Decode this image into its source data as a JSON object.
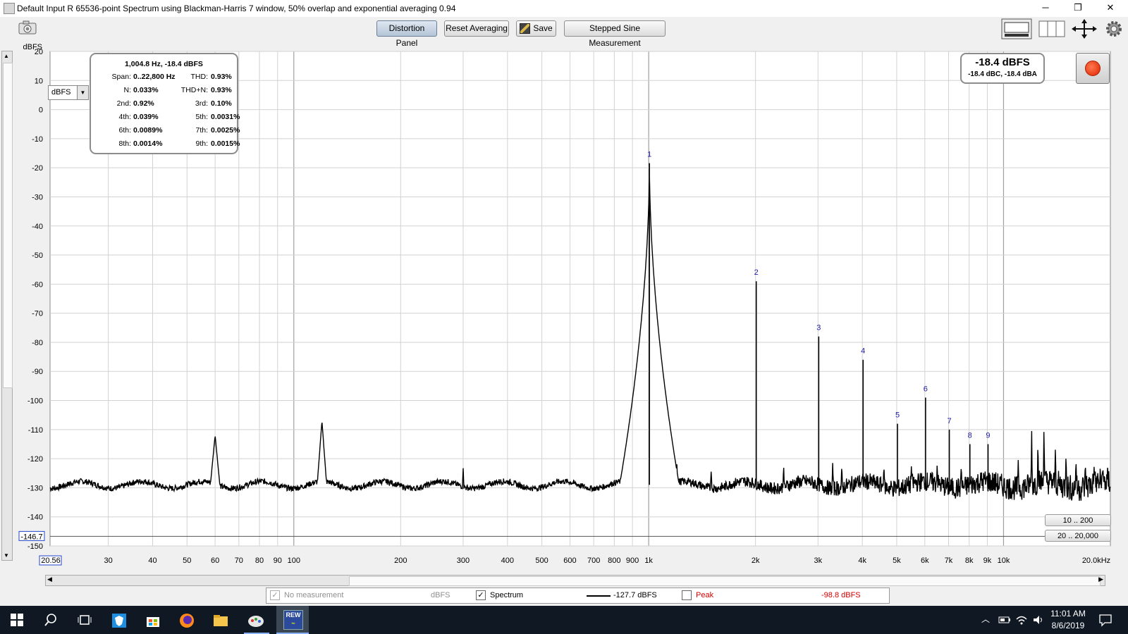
{
  "window": {
    "title": "Default Input R 65536-point Spectrum using Blackman-Harris 7 window, 50% overlap and exponential averaging 0.94",
    "minimize_glyph": "─",
    "restore_glyph": "❐",
    "close_glyph": "✕"
  },
  "toolbar": {
    "distortion_panel": "Distortion Panel",
    "reset_averaging": "Reset Averaging",
    "save": "Save",
    "stepped_sine": "Stepped Sine Measurement"
  },
  "icons": {
    "camera": "camera-icon",
    "screen_layout": "screen-layout-icon",
    "columns": "columns-icon",
    "expand": "expand-arrows-icon",
    "gear": "gear-icon",
    "record": "record-icon"
  },
  "distortion": {
    "header": "1,004.8 Hz, -18.4 dBFS",
    "rows": [
      {
        "l1": "Span:",
        "v1": "0..22,800 Hz",
        "l2": "THD:",
        "v2": "0.93%"
      },
      {
        "l1": "N:",
        "v1": "0.033%",
        "l2": "THD+N:",
        "v2": "0.93%"
      },
      {
        "l1": "2nd:",
        "v1": "0.92%",
        "l2": "3rd:",
        "v2": "0.10%"
      },
      {
        "l1": "4th:",
        "v1": "0.039%",
        "l2": "5th:",
        "v2": "0.0031%"
      },
      {
        "l1": "6th:",
        "v1": "0.0089%",
        "l2": "7th:",
        "v2": "0.0025%"
      },
      {
        "l1": "8th:",
        "v1": "0.0014%",
        "l2": "9th:",
        "v2": "0.0015%"
      }
    ]
  },
  "level": {
    "main": "-18.4 dBFS",
    "sub": "-18.4 dBC, -18.4 dBA"
  },
  "unit_select": {
    "value": "dBFS"
  },
  "range_buttons": {
    "r1": "10 .. 200",
    "r2": "20 .. 20,000"
  },
  "legend": {
    "no_measurement": "No measurement",
    "no_measurement_unit": "dBFS",
    "spectrum": "Spectrum",
    "spectrum_value": "-127.7 dBFS",
    "peak": "Peak",
    "peak_value": "-98.8 dBFS",
    "peak_color": "#d40000"
  },
  "chart_data": {
    "type": "line",
    "ylabel": "dBFS",
    "xscale": "log",
    "xlim": [
      20.56,
      20000
    ],
    "ylim": [
      -150,
      20
    ],
    "grid": true,
    "y_ticks": [
      "20",
      "10",
      "0",
      "-10",
      "-20",
      "-30",
      "-40",
      "-50",
      "-60",
      "-70",
      "-80",
      "-90",
      "-100",
      "-110",
      "-120",
      "-130",
      "-140",
      "-150"
    ],
    "x_ticks": [
      {
        "f": 30,
        "label": "30"
      },
      {
        "f": 40,
        "label": "40"
      },
      {
        "f": 50,
        "label": "50"
      },
      {
        "f": 60,
        "label": "60"
      },
      {
        "f": 70,
        "label": "70"
      },
      {
        "f": 80,
        "label": "80"
      },
      {
        "f": 90,
        "label": "90"
      },
      {
        "f": 100,
        "label": "100"
      },
      {
        "f": 200,
        "label": "200"
      },
      {
        "f": 300,
        "label": "300"
      },
      {
        "f": 400,
        "label": "400"
      },
      {
        "f": 500,
        "label": "500"
      },
      {
        "f": 600,
        "label": "600"
      },
      {
        "f": 700,
        "label": "700"
      },
      {
        "f": 800,
        "label": "800"
      },
      {
        "f": 900,
        "label": "900"
      },
      {
        "f": 1000,
        "label": "1k"
      },
      {
        "f": 2000,
        "label": "2k"
      },
      {
        "f": 3000,
        "label": "3k"
      },
      {
        "f": 4000,
        "label": "4k"
      },
      {
        "f": 5000,
        "label": "5k"
      },
      {
        "f": 6000,
        "label": "6k"
      },
      {
        "f": 7000,
        "label": "7k"
      },
      {
        "f": 8000,
        "label": "8k"
      },
      {
        "f": 9000,
        "label": "9k"
      },
      {
        "f": 10000,
        "label": "10k"
      },
      {
        "f": 20000,
        "label": "20.0kHz"
      }
    ],
    "x_start_label": "20.56",
    "y_cursor_label": "-146.7",
    "y_cursor_value": -146.7,
    "noise_floor_db": -129,
    "spurs": [
      {
        "f": 60,
        "db": -112
      },
      {
        "f": 120,
        "db": -107
      },
      {
        "f": 300,
        "db": -123
      },
      {
        "f": 1200,
        "db": -121
      },
      {
        "f": 1500,
        "db": -124
      },
      {
        "f": 2400,
        "db": -122
      },
      {
        "f": 3300,
        "db": -121
      },
      {
        "f": 3500,
        "db": -122
      },
      {
        "f": 4600,
        "db": -122
      },
      {
        "f": 5500,
        "db": -122
      },
      {
        "f": 6500,
        "db": -121
      },
      {
        "f": 7600,
        "db": -122
      },
      {
        "f": 11000,
        "db": -120
      },
      {
        "f": 12000,
        "db": -110
      },
      {
        "f": 12500,
        "db": -113
      },
      {
        "f": 13000,
        "db": -108
      },
      {
        "f": 14000,
        "db": -115
      },
      {
        "f": 15000,
        "db": -118
      },
      {
        "f": 16000,
        "db": -120
      },
      {
        "f": 17000,
        "db": -121
      },
      {
        "f": 18000,
        "db": -122
      },
      {
        "f": 19000,
        "db": -123
      }
    ],
    "harmonics": [
      {
        "label": "1",
        "f": 1004.8,
        "db": -18.4
      },
      {
        "label": "2",
        "f": 2009.6,
        "db": -59
      },
      {
        "label": "3",
        "f": 3014.4,
        "db": -78
      },
      {
        "label": "4",
        "f": 4019.2,
        "db": -86
      },
      {
        "label": "5",
        "f": 5024,
        "db": -108
      },
      {
        "label": "6",
        "f": 6028.8,
        "db": -99
      },
      {
        "label": "7",
        "f": 7033.6,
        "db": -110
      },
      {
        "label": "8",
        "f": 8038.4,
        "db": -115
      },
      {
        "label": "9",
        "f": 9043.2,
        "db": -115
      }
    ],
    "colors": {
      "trace": "#000000",
      "harmonic_label": "#1a1aa6",
      "grid_major": "#9e9e9e",
      "grid_minor": "#d2d2d2"
    }
  },
  "taskbar": {
    "time": "11:01 AM",
    "date": "8/6/2019"
  }
}
